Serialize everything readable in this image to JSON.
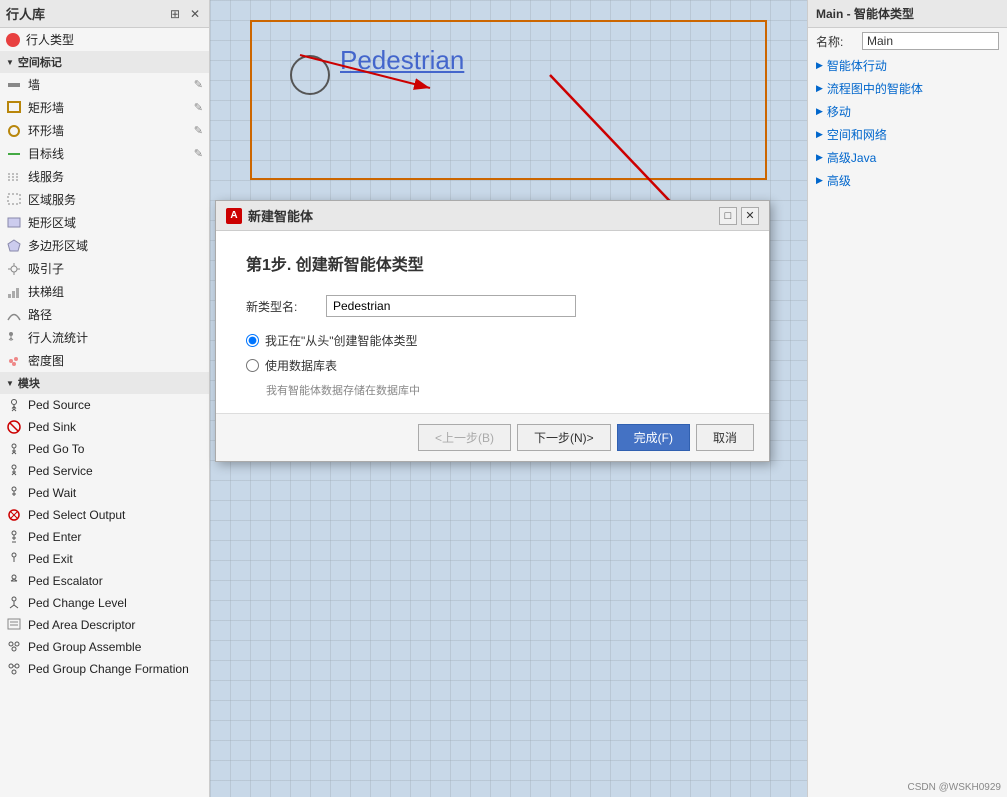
{
  "sidebar": {
    "title": "行人库",
    "header_icons": [
      "grid-icon",
      "close-icon"
    ],
    "top_section": {
      "label": "行人类型",
      "icon": "red-circle"
    },
    "spatial_section": {
      "label": "空间标记",
      "items": [
        {
          "label": "墙",
          "has_edit": true
        },
        {
          "label": "矩形墙",
          "has_edit": true
        },
        {
          "label": "环形墙",
          "has_edit": true
        },
        {
          "label": "目标线",
          "has_edit": true
        },
        {
          "label": "线服务"
        },
        {
          "label": "区域服务"
        },
        {
          "label": "矩形区域"
        },
        {
          "label": "多边形区域"
        },
        {
          "label": "吸引子"
        },
        {
          "label": "扶梯组"
        },
        {
          "label": "路径"
        },
        {
          "label": "行人流统计"
        },
        {
          "label": "密度图"
        }
      ]
    },
    "module_section": {
      "label": "模块",
      "items": [
        {
          "label": "Ped Source"
        },
        {
          "label": "Ped Sink"
        },
        {
          "label": "Ped Go To"
        },
        {
          "label": "Ped Service"
        },
        {
          "label": "Ped Wait"
        },
        {
          "label": "Ped Select Output"
        },
        {
          "label": "Ped Enter"
        },
        {
          "label": "Ped Exit"
        },
        {
          "label": "Ped Escalator"
        },
        {
          "label": "Ped Change Level"
        },
        {
          "label": "Ped Area Descriptor"
        },
        {
          "label": "Ped Group Assemble"
        },
        {
          "label": "Ped Group Change Formation"
        }
      ]
    }
  },
  "canvas": {
    "pedestrian_label": "Pedestrian"
  },
  "right_panel": {
    "header": "Main - 智能体类型",
    "name_label": "名称:",
    "name_value": "Main",
    "sections": [
      {
        "label": "智能体行动"
      },
      {
        "label": "流程图中的智能体"
      },
      {
        "label": "移动"
      },
      {
        "label": "空间和网络"
      },
      {
        "label": "高级Java"
      },
      {
        "label": "高级"
      }
    ]
  },
  "modal": {
    "title_icon": "A",
    "title": "新建智能体",
    "step_title": "第1步. 创建新智能体类型",
    "field_label": "新类型名:",
    "field_value": "Pedestrian",
    "radio1_label": "我正在\"从头\"创建智能体类型",
    "radio2_label": "使用数据库表",
    "note": "我有智能体数据存储在数据库中",
    "buttons": {
      "prev": "<上一步(B)",
      "next": "下一步(N)>",
      "finish": "完成(F)",
      "cancel": "取消"
    }
  },
  "watermark": "CSDN @WSKH0929"
}
